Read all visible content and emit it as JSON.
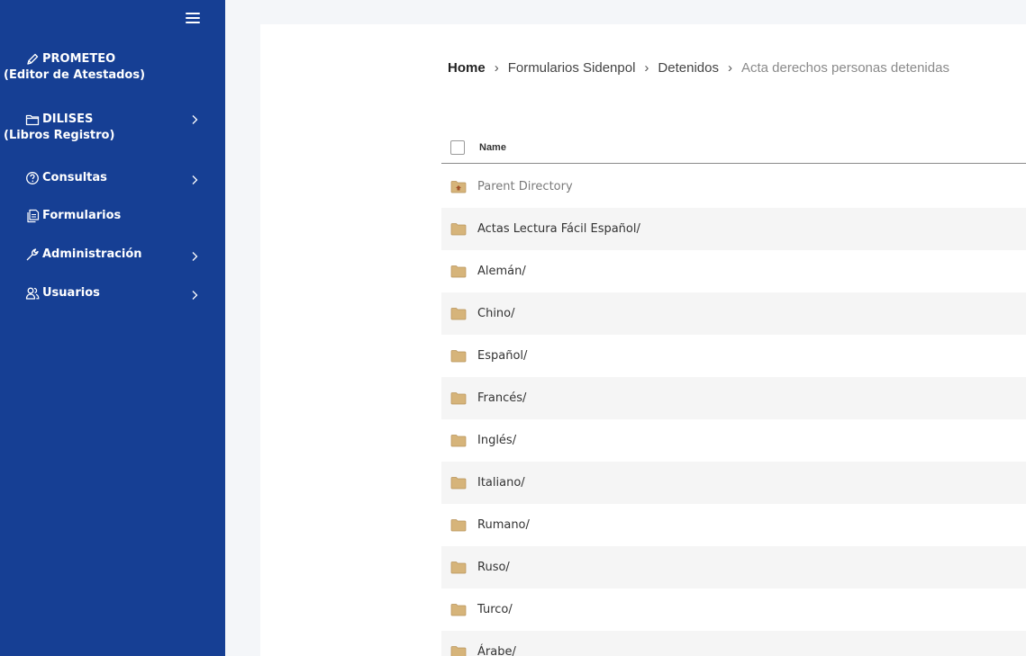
{
  "sidebar": {
    "items": [
      {
        "label": "PROMETEO",
        "sublabel": "(Editor de Atestados)",
        "icon": "pencil-icon",
        "has_chevron": false
      },
      {
        "label": "DILISES",
        "sublabel": "(Libros Registro)",
        "icon": "folder-icon",
        "has_chevron": true
      },
      {
        "label": "Consultas",
        "icon": "question-circle-icon",
        "has_chevron": true
      },
      {
        "label": "Formularios",
        "icon": "documents-icon",
        "has_chevron": false
      },
      {
        "label": "Administración",
        "icon": "wrench-icon",
        "has_chevron": true
      },
      {
        "label": "Usuarios",
        "icon": "users-icon",
        "has_chevron": true
      }
    ]
  },
  "breadcrumb": {
    "home": "Home",
    "items": [
      "Formularios Sidenpol",
      "Detenidos"
    ],
    "current": "Acta derechos personas detenidas"
  },
  "table": {
    "header": "Name",
    "rows": [
      {
        "label": "Parent Directory",
        "type": "parent"
      },
      {
        "label": "Actas Lectura Fácil Español/",
        "type": "folder"
      },
      {
        "label": "Alemán/",
        "type": "folder"
      },
      {
        "label": "Chino/",
        "type": "folder"
      },
      {
        "label": "Español/",
        "type": "folder"
      },
      {
        "label": "Francés/",
        "type": "folder"
      },
      {
        "label": "Inglés/",
        "type": "folder"
      },
      {
        "label": "Italiano/",
        "type": "folder"
      },
      {
        "label": "Rumano/",
        "type": "folder"
      },
      {
        "label": "Ruso/",
        "type": "folder"
      },
      {
        "label": "Turco/",
        "type": "folder"
      },
      {
        "label": "Árabe/",
        "type": "folder"
      }
    ]
  },
  "colors": {
    "sidebar": "#163f94",
    "folder": "#d6b47a",
    "row_alt": "#f5f5f5"
  }
}
